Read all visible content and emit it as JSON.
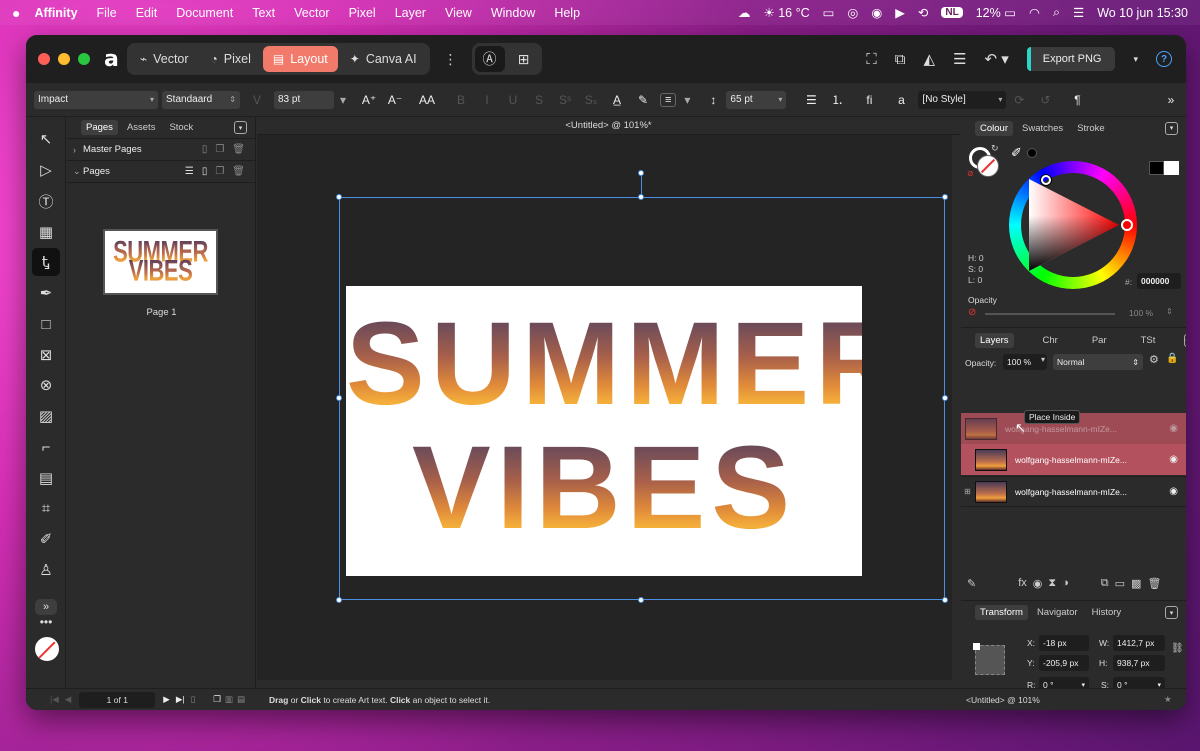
{
  "menubar": {
    "apple": "",
    "app_name": "Affinity",
    "items": [
      "File",
      "Edit",
      "Document",
      "Text",
      "Vector",
      "Pixel",
      "Layer",
      "View",
      "Window",
      "Help"
    ],
    "weather": "16 °C",
    "input_source": "NL",
    "battery": "12%",
    "clock": "Wo 10 jun  15:30"
  },
  "titlebar": {
    "logo": "a",
    "personas": [
      {
        "label": "Vector",
        "icon": "vector-persona-icon"
      },
      {
        "label": "Pixel",
        "icon": "pixel-persona-icon"
      },
      {
        "label": "Layout",
        "icon": "layout-persona-icon",
        "active": true
      },
      {
        "label": "Canva AI",
        "icon": "canva-ai-icon"
      }
    ],
    "export_label": "Export PNG",
    "help": "?"
  },
  "context": {
    "font_family": "Impact",
    "font_style": "Standaard",
    "font_size": "83 pt",
    "leading": "65 pt",
    "text_style": "[No Style]",
    "case_label": "AA",
    "ligature_label": "fi",
    "a_label": "a",
    "pilcrow": "¶"
  },
  "pages_panel": {
    "tabs": [
      "Pages",
      "Assets",
      "Stock"
    ],
    "master_pages_label": "Master Pages",
    "pages_label": "Pages",
    "thumb_line1": "SUMMER",
    "thumb_line2": "VIBES",
    "page_name": "Page 1"
  },
  "canvas": {
    "doc_title": "<Untitled> @ 101%*",
    "line1": "SUMMER",
    "line2": "VIBES"
  },
  "colour_panel": {
    "tabs": [
      "Colour",
      "Swatches",
      "Stroke"
    ],
    "h": "H: 0",
    "s": "S: 0",
    "l": "L: 0",
    "hex_label": "#:",
    "hex_value": "000000",
    "opacity_label": "Opacity",
    "opacity_value": "100 %"
  },
  "layers_panel": {
    "tabs": [
      "Layers",
      "Chr",
      "Par",
      "TSt"
    ],
    "opacity_label": "Opacity:",
    "opacity_value": "100 %",
    "blend_mode": "Normal",
    "tooltip": "Place Inside",
    "layers": [
      {
        "name": "wolfgang-hasselmann-mIZe..."
      },
      {
        "name": "wolfgang-hasselmann-mIZe..."
      },
      {
        "name": "wolfgang-hasselmann-mIZe..."
      }
    ]
  },
  "transform_panel": {
    "tabs": [
      "Transform",
      "Navigator",
      "History"
    ],
    "x_label": "X:",
    "x_value": "-18 px",
    "y_label": "Y:",
    "y_value": "-205,9 px",
    "w_label": "W:",
    "w_value": "1412,7 px",
    "h_label": "H:",
    "h_value": "938,7 px",
    "r_label": "R:",
    "r_value": "0 °",
    "s_label": "S:",
    "s_value": "0 °"
  },
  "status": {
    "page_counter": "1 of 1",
    "hint_drag": "Drag",
    "hint_or": " or ",
    "hint_click": "Click",
    "hint_rest": " to create Art text. ",
    "hint_click2": "Click",
    "hint_rest2": " an object to select it.",
    "right_title": "<Untitled> @ 101%"
  }
}
